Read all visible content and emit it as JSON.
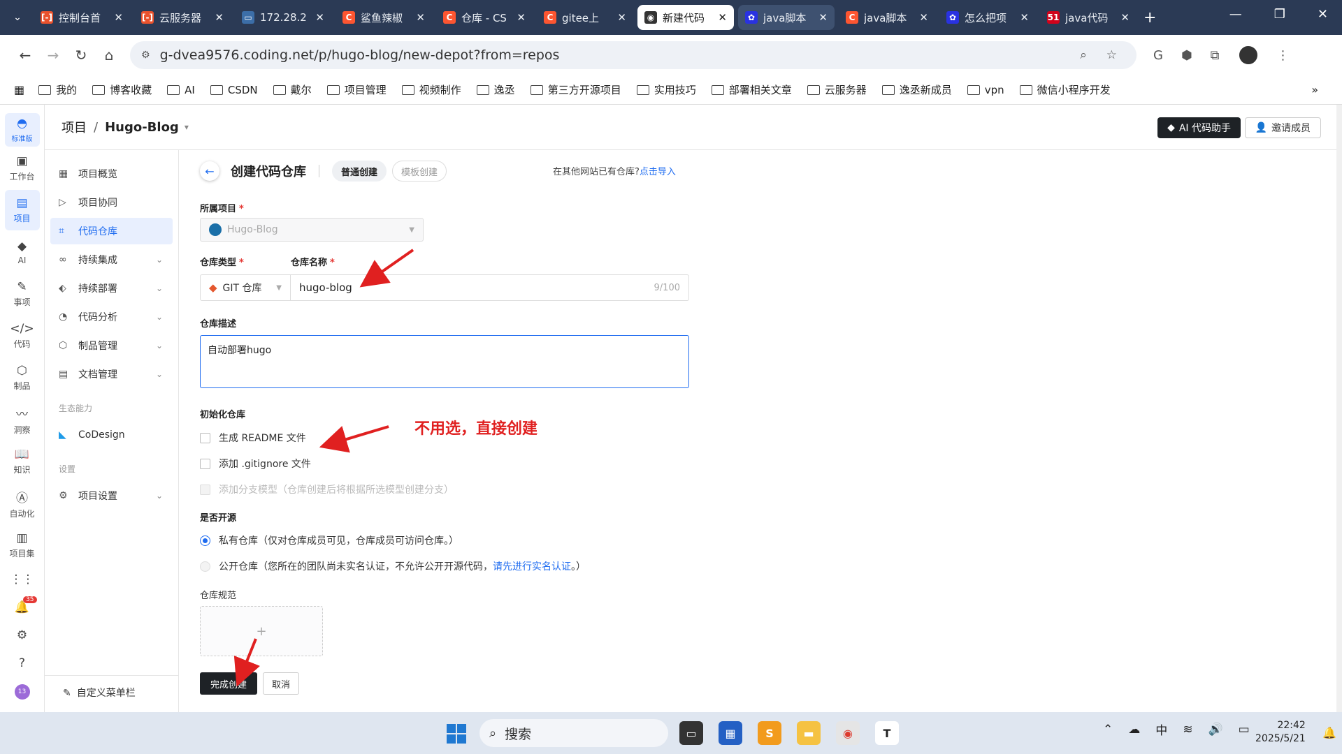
{
  "browser": {
    "tabs": [
      {
        "label": "控制台首"
      },
      {
        "label": "云服务器"
      },
      {
        "label": "172.28.2"
      },
      {
        "label": "鲨鱼辣椒"
      },
      {
        "label": "仓库 - CS"
      },
      {
        "label": "gitee上"
      },
      {
        "label": "新建代码"
      },
      {
        "label": "java脚本"
      },
      {
        "label": "java脚本"
      },
      {
        "label": "怎么把项"
      },
      {
        "label": "java代码"
      }
    ],
    "url": "g-dvea9576.coding.net/p/hugo-blog/new-depot?from=repos",
    "bookmarks": [
      "我的",
      "博客收藏",
      "AI",
      "CSDN",
      "戴尔",
      "项目管理",
      "视频制作",
      "逸丞",
      "第三方开源项目",
      "实用技巧",
      "部署相关文章",
      "云服务器",
      "逸丞新成员",
      "vpn",
      "微信小程序开发"
    ]
  },
  "rail": {
    "brand": "标准版",
    "items": [
      {
        "label": "工作台",
        "icon": "dashboard-icon"
      },
      {
        "label": "项目",
        "icon": "project-icon"
      },
      {
        "label": "AI",
        "icon": "ai-icon"
      },
      {
        "label": "事项",
        "icon": "issue-icon"
      },
      {
        "label": "代码",
        "icon": "code-icon"
      },
      {
        "label": "制品",
        "icon": "artifact-icon"
      },
      {
        "label": "洞察",
        "icon": "insight-icon"
      },
      {
        "label": "知识",
        "icon": "knowledge-icon"
      },
      {
        "label": "自动化",
        "icon": "automation-icon"
      },
      {
        "label": "项目集",
        "icon": "program-icon"
      }
    ],
    "badge": "35",
    "user_badge": "13"
  },
  "header": {
    "root": "项目",
    "project": "Hugo-Blog",
    "ai_button": "AI 代码助手",
    "invite_button": "邀请成员"
  },
  "sidebar": {
    "items": [
      {
        "label": "项目概览"
      },
      {
        "label": "项目协同"
      },
      {
        "label": "代码仓库"
      },
      {
        "label": "持续集成"
      },
      {
        "label": "持续部署"
      },
      {
        "label": "代码分析"
      },
      {
        "label": "制品管理"
      },
      {
        "label": "文档管理"
      }
    ],
    "section_eco": "生态能力",
    "codesign": "CoDesign",
    "section_settings": "设置",
    "project_settings": "项目设置",
    "footer": "自定义菜单栏"
  },
  "form": {
    "title": "创建代码仓库",
    "mode_normal": "普通创建",
    "mode_template": "模板创建",
    "import_tip": "在其他网站已有仓库?",
    "import_link": "点击导入",
    "project_label": "所属项目",
    "project_value": "Hugo-Blog",
    "type_label": "仓库类型",
    "type_value": "GIT 仓库",
    "name_label": "仓库名称",
    "name_value": "hugo-blog",
    "name_counter": "9/100",
    "desc_label": "仓库描述",
    "desc_value": "自动部署hugo",
    "init_label": "初始化仓库",
    "opt_readme": "生成 README 文件",
    "opt_gitignore": "添加 .gitignore 文件",
    "opt_branch": "添加分支模型（仓库创建后将根据所选模型创建分支）",
    "open_label": "是否开源",
    "private_option": "私有仓库（仅对仓库成员可见，仓库成员可访问仓库。）",
    "public_option": "公开仓库（您所在的团队尚未实名认证，不允许公开开源代码，",
    "public_link": "请先进行实名认证",
    "public_tail": "。）",
    "spec_label": "仓库规范",
    "submit": "完成创建",
    "cancel": "取消",
    "annotation": "不用选，直接创建"
  },
  "taskbar": {
    "search": "搜索",
    "time": "22:42",
    "date": "2025/5/21",
    "ime": "中"
  }
}
